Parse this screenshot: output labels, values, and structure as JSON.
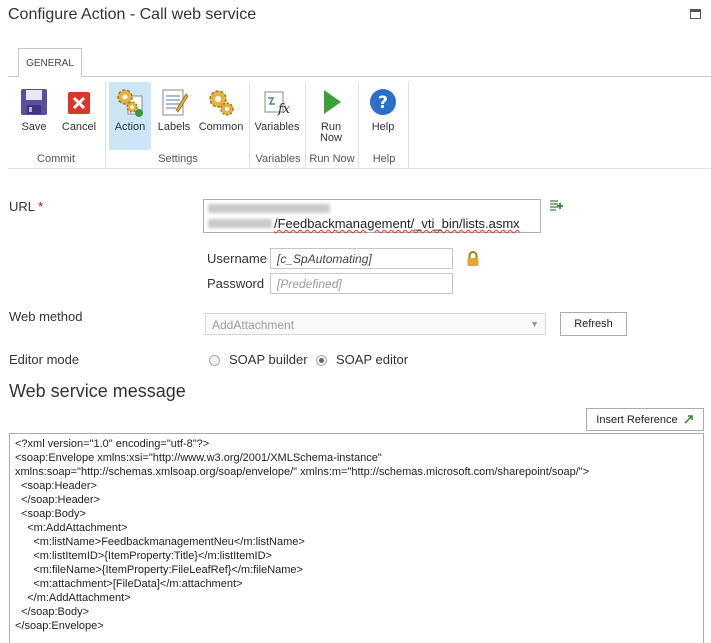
{
  "window": {
    "title": "Configure Action - Call web service"
  },
  "ribbon": {
    "tab": "GENERAL",
    "buttons": {
      "save": "Save",
      "cancel": "Cancel",
      "action": "Action",
      "labels": "Labels",
      "common": "Common",
      "variables": "Variables",
      "run_now_1": "Run",
      "run_now_2": "Now",
      "help": "Help"
    },
    "groups": {
      "commit": "Commit",
      "settings": "Settings",
      "variables": "Variables",
      "run_now": "Run Now",
      "help": "Help"
    }
  },
  "form": {
    "url_label": "URL",
    "required_mark": "*",
    "url_visible_part": "/Feedbackmanagement/_vti_bin/lists.asmx",
    "username_label": "Username",
    "username_value": "[c_SpAutomating]",
    "password_label": "Password",
    "password_placeholder": "[Predefined]",
    "web_method_label": "Web method",
    "web_method_value": "AddAttachment",
    "refresh_label": "Refresh",
    "editor_mode_label": "Editor mode",
    "editor_options": [
      "SOAP builder",
      "SOAP editor"
    ],
    "editor_selected": "SOAP editor"
  },
  "message": {
    "title": "Web service message",
    "insert_reference_label": "Insert Reference",
    "lines": [
      "<?xml version=\"1.0\" encoding=\"utf-8\"?>",
      "<soap:Envelope xmlns:xsi=\"http://www.w3.org/2001/XMLSchema-instance\"",
      "xmlns:soap=\"http://schemas.xmlsoap.org/soap/envelope/\" xmlns:m=\"http://schemas.microsoft.com/sharepoint/soap/\">",
      "  <soap:Header>",
      "  </soap:Header>",
      "  <soap:Body>",
      "    <m:AddAttachment>",
      "      <m:listName>FeedbackmanagementNeu</m:listName>",
      "      <m:listItemID>{ItemProperty:Title}</m:listItemID>",
      "      <m:fileName>{ItemProperty:FileLeafRef}</m:fileName>",
      "      <m:attachment>[FileData]</m:attachment>",
      "    </m:AddAttachment>",
      "  </soap:Body>",
      "</soap:Envelope>"
    ]
  }
}
